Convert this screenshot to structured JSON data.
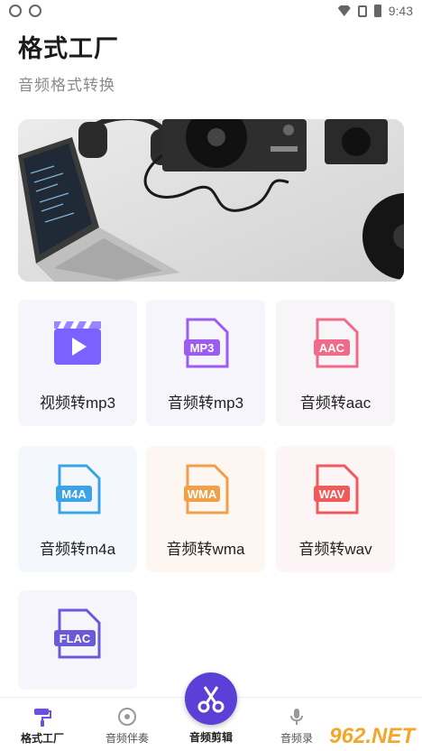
{
  "status": {
    "time": "9:43"
  },
  "header": {
    "title": "格式工厂",
    "subtitle": "音频格式转换"
  },
  "tiles": [
    {
      "label": "视频转mp3",
      "icon": "video-clapper-icon",
      "color": "#7b61ff",
      "bg": "#f6f5fb"
    },
    {
      "label": "音频转mp3",
      "icon": "mp3-file-icon",
      "badge": "MP3",
      "color": "#9b5cf0",
      "bg": "#f6f5fb"
    },
    {
      "label": "音频转aac",
      "icon": "aac-file-icon",
      "badge": "AAC",
      "color": "#f06a8a",
      "bg": "#f7f5f8"
    },
    {
      "label": "音频转m4a",
      "icon": "m4a-file-icon",
      "badge": "M4A",
      "color": "#3ba3e6",
      "bg": "#f4f8fc"
    },
    {
      "label": "音频转wma",
      "icon": "wma-file-icon",
      "badge": "WMA",
      "color": "#f0a04b",
      "bg": "#fdf6f1"
    },
    {
      "label": "音频转wav",
      "icon": "wav-file-icon",
      "badge": "WAV",
      "color": "#ef5a5a",
      "bg": "#fdf5f5"
    },
    {
      "label": "",
      "icon": "flac-file-icon",
      "badge": "FLAC",
      "color": "#6a5ad6",
      "bg": "#f6f5fb"
    }
  ],
  "nav": {
    "items": [
      {
        "label": "格式工厂",
        "icon": "paint-roller-icon"
      },
      {
        "label": "音频伴奏",
        "icon": "music-disc-icon"
      },
      {
        "label": "音频剪辑",
        "icon": "scissors-icon"
      },
      {
        "label": "音频录",
        "icon": "microphone-icon"
      }
    ]
  },
  "watermark": "962.NET"
}
